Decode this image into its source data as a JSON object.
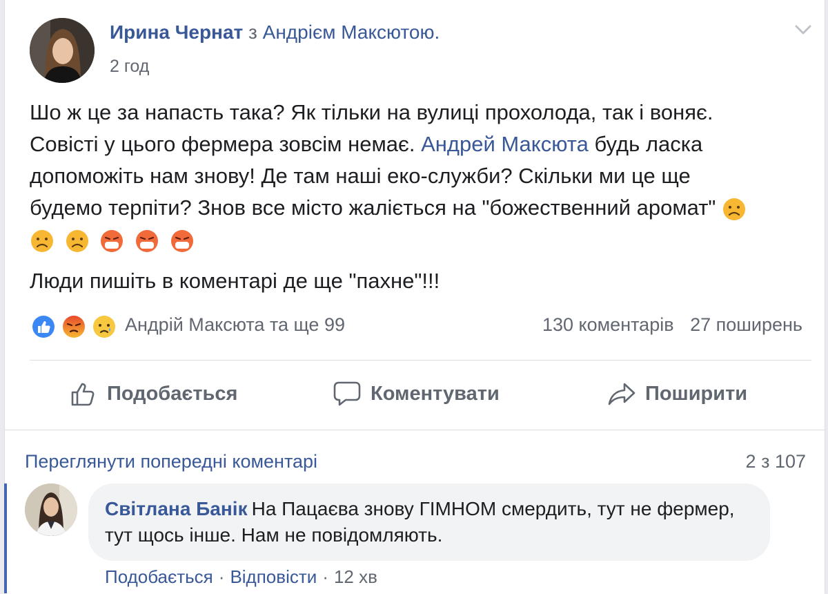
{
  "post": {
    "author": "Ирина Чернат",
    "with_word": "з",
    "tagged": "Андрієм Максютою.",
    "time": "2 год",
    "text": {
      "l1": "Шо ж це за напасть така? Як тільки на вулиці прохолода, так і воняє.",
      "l2_pre": "Совісті у цього фермера зовсім немає.",
      "mention": "Андрей Максюта",
      "l2_post": "будь ласка",
      "l3": "допоможіть нам знову! Де там наші еко-служби? Скільки ми це ще",
      "l4": "будемо терпіти? Знов все місто жаліється на \"божественний аромат\"",
      "l5": "Люди пишіть в коментарі де ще \"пахне\"!!!"
    }
  },
  "reactions": {
    "types": [
      "like-icon",
      "angry-icon",
      "sad-icon"
    ],
    "names": "Андрій Максюта та ще 99",
    "comments": "130 коментарів",
    "shares": "27 поширень"
  },
  "actions": {
    "like": "Подобається",
    "comment": "Коментувати",
    "share": "Поширити"
  },
  "comments": {
    "view_previous": "Переглянути попередні коментарі",
    "pager": "2 з 107",
    "item": {
      "author": "Світлана Банік",
      "text": "На Пацаєва знову ГІМНОМ смердить, тут не фермер, тут щось інше. Нам не повідомляють.",
      "like": "Подобається",
      "reply": "Відповісти",
      "time": "12 хв"
    }
  },
  "colors": {
    "link": "#385898",
    "secondary_text": "#616770",
    "accent": "#4267b2",
    "bubble": "#f2f3f5"
  }
}
